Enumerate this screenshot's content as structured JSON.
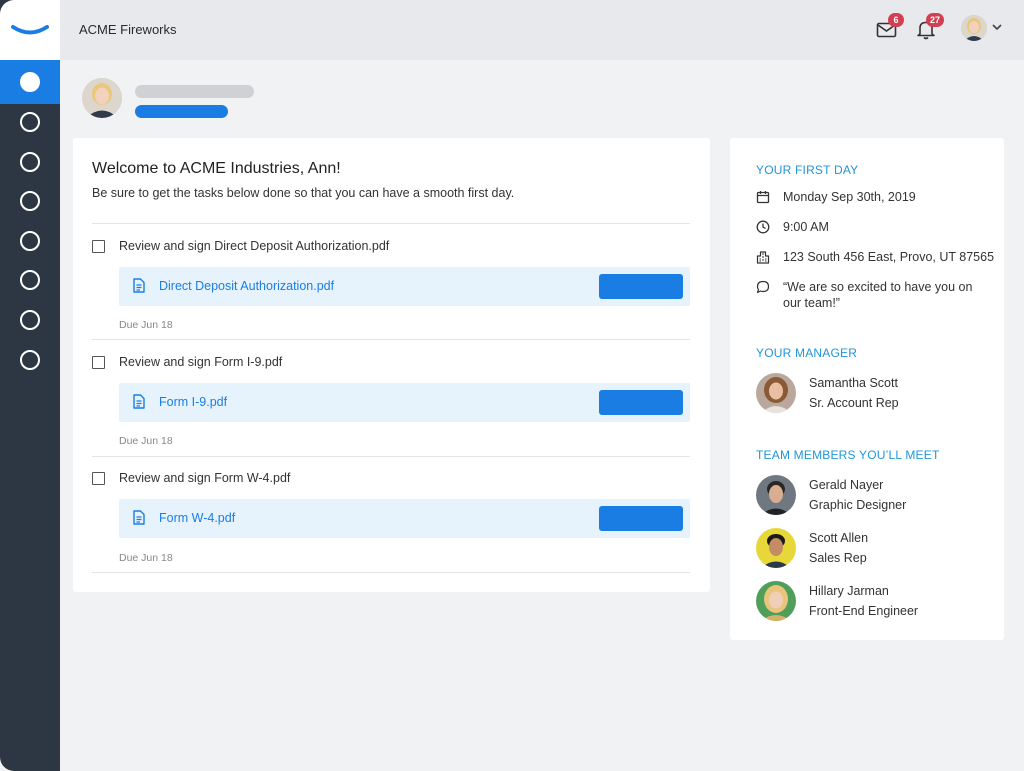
{
  "header": {
    "app_title": "ACME Fireworks",
    "mail_count": "6",
    "notification_count": "27"
  },
  "sidebar": {
    "items": [
      {
        "id": "nav-1",
        "active": true
      },
      {
        "id": "nav-2",
        "active": false
      },
      {
        "id": "nav-3",
        "active": false
      },
      {
        "id": "nav-4",
        "active": false
      },
      {
        "id": "nav-5",
        "active": false
      },
      {
        "id": "nav-6",
        "active": false
      },
      {
        "id": "nav-7",
        "active": false
      },
      {
        "id": "nav-8",
        "active": false
      }
    ]
  },
  "welcome": {
    "title": "Welcome to ACME Industries, Ann!",
    "subtitle": "Be sure to get the tasks below done so that you can have a smooth first day."
  },
  "tasks": [
    {
      "label": "Review and sign Direct Deposit Authorization.pdf",
      "file": "Direct Deposit Authorization.pdf",
      "due": "Due Jun 18"
    },
    {
      "label": "Review and sign Form I-9.pdf",
      "file": "Form I-9.pdf",
      "due": "Due Jun 18"
    },
    {
      "label": "Review and sign Form W-4.pdf",
      "file": "Form W-4.pdf",
      "due": "Due Jun 18"
    }
  ],
  "first_day": {
    "heading": "YOUR FIRST DAY",
    "date": "Monday Sep 30th, 2019",
    "time": "9:00 AM",
    "address": "123 South 456 East, Provo, UT 87565",
    "message": "“We are so excited to have you on our team!”"
  },
  "manager": {
    "heading": "YOUR MANAGER",
    "name": "Samantha Scott",
    "role": "Sr. Account Rep"
  },
  "team": {
    "heading": "TEAM MEMBERS YOU’LL MEET",
    "members": [
      {
        "name": "Gerald Nayer",
        "role": "Graphic Designer"
      },
      {
        "name": "Scott Allen",
        "role": "Sales Rep"
      },
      {
        "name": "Hillary Jarman",
        "role": "Front-End Engineer"
      }
    ]
  },
  "colors": {
    "accent": "#1a7de3",
    "sidebar": "#2d3743",
    "heading": "#2196d8",
    "badge": "#d23f52"
  }
}
